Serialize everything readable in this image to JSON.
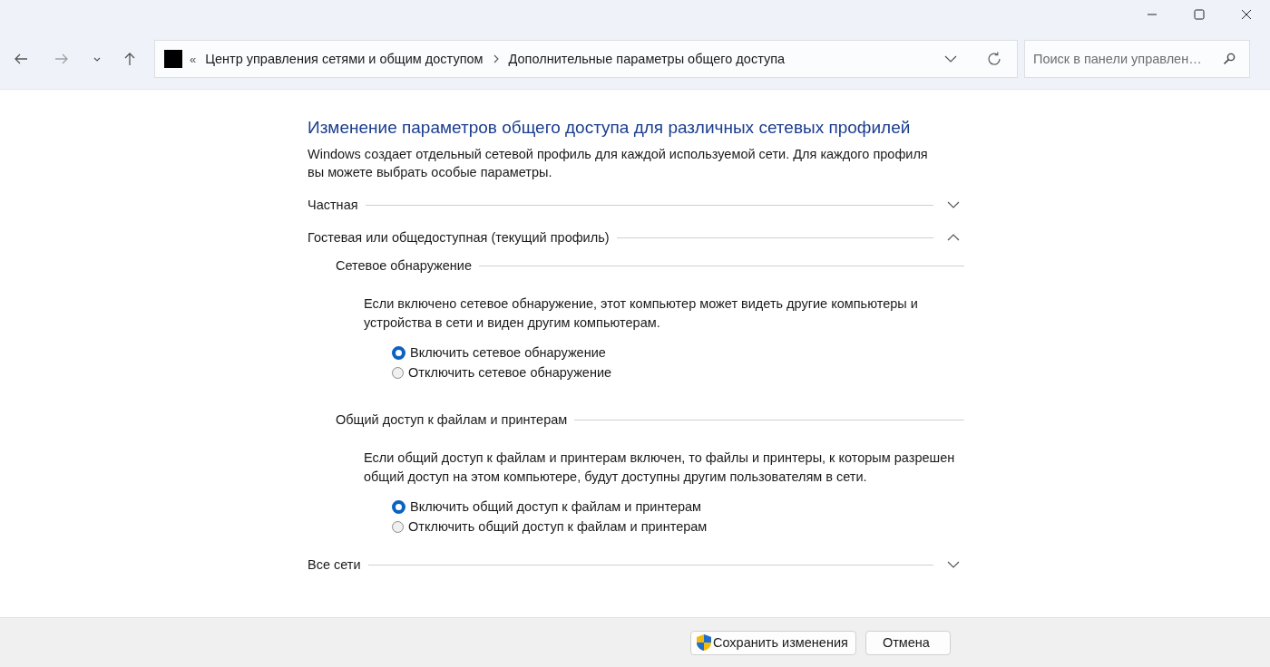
{
  "nav": [
    {
      "kind": "back",
      "disabled": false
    },
    {
      "kind": "forward",
      "disabled": true
    },
    {
      "kind": "recent",
      "disabled": false
    },
    {
      "kind": "up",
      "disabled": false
    }
  ],
  "address_bar": {
    "overflow": "«",
    "crumbs": [
      "Центр управления сетями и общим доступом",
      "Дополнительные параметры общего доступа"
    ]
  },
  "search": {
    "placeholder": "Поиск в панели управлен…"
  },
  "heading": "Изменение параметров общего доступа для различных сетевых профилей",
  "intro": "Windows создает отдельный сетевой профиль для каждой используемой сети. Для каждого профиля вы можете выбрать особые параметры.",
  "profiles": [
    {
      "label": "Частная",
      "expanded": false
    },
    {
      "label": "Гостевая или общедоступная (текущий профиль)",
      "expanded": true,
      "sections": [
        {
          "title": "Сетевое обнаружение",
          "description": "Если включено сетевое обнаружение, этот компьютер может видеть другие компьютеры и устройства в сети и виден другим компьютерам.",
          "options": [
            {
              "label": "Включить сетевое обнаружение",
              "selected": true
            },
            {
              "label": "Отключить сетевое обнаружение",
              "selected": false
            }
          ]
        },
        {
          "title": "Общий доступ к файлам и принтерам",
          "description": "Если общий доступ к файлам и принтерам включен, то файлы и принтеры, к которым разрешен общий доступ на этом компьютере, будут доступны другим пользователям в сети.",
          "options": [
            {
              "label": "Включить общий доступ к файлам и принтерам",
              "selected": true
            },
            {
              "label": "Отключить общий доступ к файлам и принтерам",
              "selected": false
            }
          ]
        }
      ]
    },
    {
      "label": "Все сети",
      "expanded": false
    }
  ],
  "buttons": [
    {
      "label": "Сохранить изменения",
      "kind": "save"
    },
    {
      "label": "Отмена",
      "kind": "cancel"
    }
  ]
}
